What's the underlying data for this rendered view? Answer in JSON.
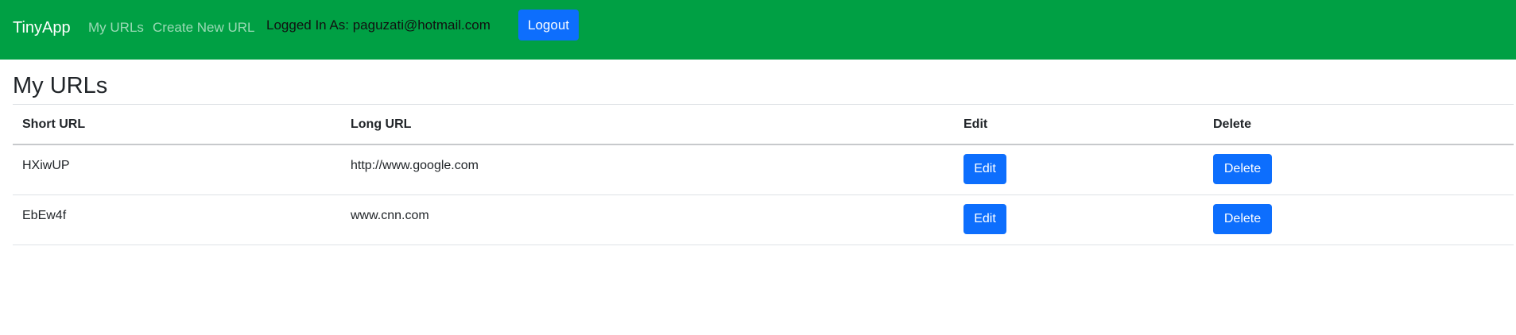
{
  "nav": {
    "brand": "TinyApp",
    "links": [
      {
        "label": "My URLs"
      },
      {
        "label": "Create New URL"
      }
    ],
    "logged_in_text": "Logged In As: paguzati@hotmail.com",
    "logout_label": "Logout"
  },
  "main": {
    "title": "My URLs",
    "table": {
      "headers": {
        "short": "Short URL",
        "long": "Long URL",
        "edit": "Edit",
        "delete": "Delete"
      },
      "rows": [
        {
          "short": "HXiwUP",
          "long": "http://www.google.com",
          "edit_label": "Edit",
          "delete_label": "Delete"
        },
        {
          "short": "EbEw4f",
          "long": "www.cnn.com",
          "edit_label": "Edit",
          "delete_label": "Delete"
        }
      ]
    }
  },
  "colors": {
    "navbar": "#00a044",
    "button": "#0d6efd"
  }
}
